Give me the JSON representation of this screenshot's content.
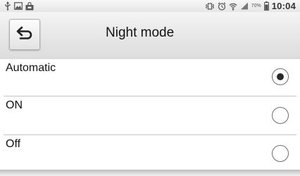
{
  "status_bar": {
    "clock": "10:04",
    "battery_percent": "70%",
    "icons": [
      "usb-icon",
      "image-icon",
      "bag-icon",
      "vibrate-icon",
      "alarm-icon",
      "wifi-icon",
      "signal-icon",
      "battery-icon"
    ]
  },
  "header": {
    "title": "Night mode",
    "back_icon": "back-arrow-icon"
  },
  "options": [
    {
      "label": "Automatic",
      "selected": true
    },
    {
      "label": "ON",
      "selected": false
    },
    {
      "label": "Off",
      "selected": false
    }
  ]
}
